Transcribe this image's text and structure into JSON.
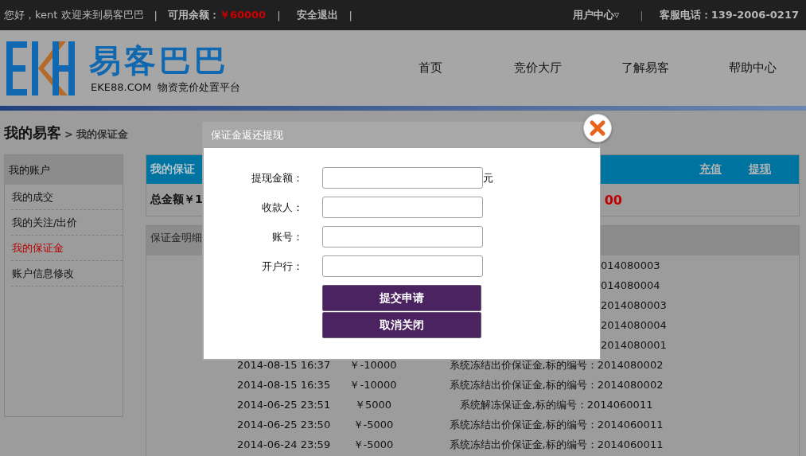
{
  "top_bar": {
    "greeting": "您好，kent 欢迎来到易客巴巴",
    "separator_1": "|",
    "balance_label": "可用余额：",
    "balance_value": "￥60000",
    "separator_2": "|",
    "logout": "安全退出",
    "separator_3": "|",
    "user_center": "用户中心▿",
    "separator_4": "|",
    "hotline": "客服电话：139-2006-0217"
  },
  "header": {
    "logo_title": "易客巴巴",
    "logo_subtitle": "EKE88.COM  物资竞价处置平台",
    "nav": [
      {
        "label": "首页"
      },
      {
        "label": "竞价大厅"
      },
      {
        "label": "了解易客"
      },
      {
        "label": "帮助中心"
      }
    ]
  },
  "breadcrumb": {
    "title": "我的易客",
    "current": "> 我的保证金"
  },
  "sidebar": {
    "title": "我的账户",
    "items": [
      {
        "label": "我的成交",
        "selected": false
      },
      {
        "label": "我的关注/出价",
        "selected": false
      },
      {
        "label": "我的保证金",
        "selected": true
      },
      {
        "label": "账户信息修改",
        "selected": false
      }
    ]
  },
  "deposit_panel": {
    "title": "我的保证",
    "links": [
      {
        "label": "充值"
      },
      {
        "label": "提现"
      }
    ],
    "total_label": "总金额￥1",
    "total_tail": "00"
  },
  "details": {
    "title": "保证金明细",
    "rows": [
      {
        "kind": "partial",
        "description": "014080003"
      },
      {
        "kind": "partial",
        "description": "014080004"
      },
      {
        "kind": "partial",
        "description": "2014080003"
      },
      {
        "kind": "partial",
        "description": "2014080004"
      },
      {
        "kind": "partial",
        "description": "2014080001"
      },
      {
        "kind": "full",
        "time": "2014-08-15 16:37",
        "amount": "￥-10000",
        "description": "系统冻结出价保证金,标的编号：2014080002"
      },
      {
        "kind": "full",
        "time": "2014-08-15 16:35",
        "amount": "￥-10000",
        "description": "系统冻结出价保证金,标的编号：2014080002"
      },
      {
        "kind": "full",
        "time": "2014-06-25 23:51",
        "amount": "￥5000",
        "description": "系统解冻保证金,标的编号：2014060011"
      },
      {
        "kind": "full",
        "time": "2014-06-25 23:50",
        "amount": "￥-5000",
        "description": "系统冻结出价保证金,标的编号：2014060011"
      },
      {
        "kind": "full",
        "time": "2014-06-24 23:59",
        "amount": "￥-5000",
        "description": "系统冻结出价保证金,标的编号：2014060011"
      }
    ]
  },
  "dialog": {
    "title": "保证金返还提现",
    "fields": [
      {
        "label": "提现金额：",
        "unit": "元"
      },
      {
        "label": "收款人："
      },
      {
        "label": "账号："
      },
      {
        "label": "开户行："
      }
    ],
    "buttons": [
      {
        "label": "提交申请"
      },
      {
        "label": "取消关闭"
      }
    ]
  }
}
